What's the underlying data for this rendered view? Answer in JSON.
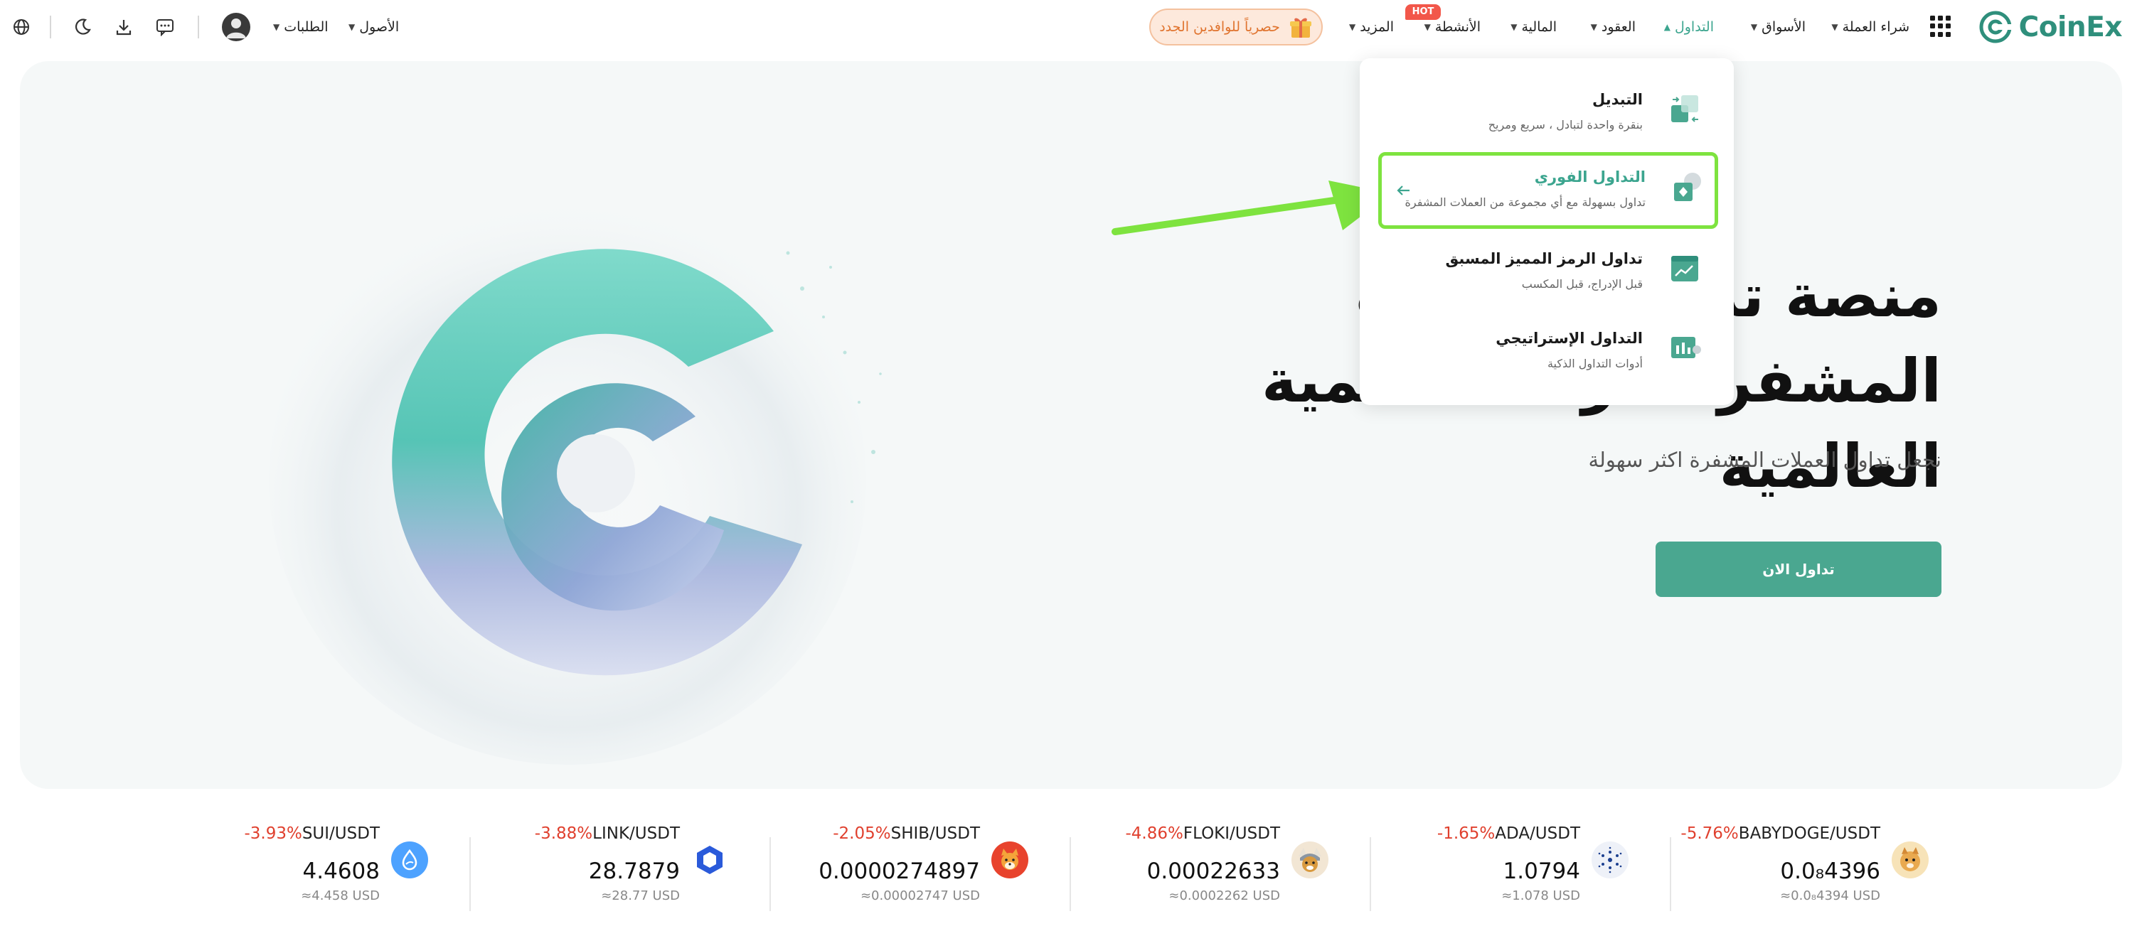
{
  "header": {
    "logo": "CoinEx",
    "nav": [
      {
        "label": "شراء العملة",
        "caret": true,
        "active": false
      },
      {
        "label": "الأسواق",
        "caret": true,
        "active": false
      },
      {
        "label": "التداول",
        "caret": true,
        "active": true
      },
      {
        "label": "العقود",
        "caret": true,
        "active": false
      },
      {
        "label": "المالية",
        "caret": true,
        "active": false
      },
      {
        "label": "الأنشطة",
        "caret": true,
        "active": false
      },
      {
        "label": "المزيد",
        "caret": true,
        "active": false
      }
    ],
    "hot_badge": "HOT",
    "promo_label": "حصرياً للوافدين الجدد",
    "assets_label": "الأصول",
    "orders_label": "الطلبات"
  },
  "dropdown": {
    "items": [
      {
        "title": "التبديل",
        "desc": "بنقرة واحدة لتبادل ، سريع ومريح",
        "icon": "swap-icon"
      },
      {
        "title": "التداول الفوري",
        "desc": "تداول بسهولة مع أي مجموعة من العملات المشفرة",
        "icon": "spot-icon",
        "highlighted": true
      },
      {
        "title": "تداول الرمز المميز المسبق",
        "desc": "قبل الإدراج، قبل المكسب",
        "icon": "pre-token-icon"
      },
      {
        "title": "التداول الإستراتيجي",
        "desc": "أدوات التداول الذكية",
        "icon": "strategy-icon"
      }
    ]
  },
  "hero": {
    "title_line1": "منصة تداول العملات المشفرة الرائدة عالمية",
    "title_line2": "العالمية",
    "subtitle": "نجعل تداول العملات المشفرة اكثر سهولة",
    "cta": "تداول الان"
  },
  "ticker": [
    {
      "pair": "BABYDOGE/USDT",
      "change": "-5.76%",
      "price": "0.0₈4396",
      "usd": "≈0.0₈4394 USD",
      "icon": "babydoge-icon",
      "color": "#f5c27a"
    },
    {
      "pair": "ADA/USDT",
      "change": "-1.65%",
      "price": "1.0794",
      "usd": "≈1.078 USD",
      "icon": "ada-icon",
      "color": "#1c3f8f"
    },
    {
      "pair": "FLOKI/USDT",
      "change": "-4.86%",
      "price": "0.00022633",
      "usd": "≈0.0002262 USD",
      "icon": "floki-icon",
      "color": "#d99a3f"
    },
    {
      "pair": "SHIB/USDT",
      "change": "-2.05%",
      "price": "0.0000274897",
      "usd": "≈0.00002747 USD",
      "icon": "shib-icon",
      "color": "#e8432d"
    },
    {
      "pair": "LINK/USDT",
      "change": "-3.88%",
      "price": "28.7879",
      "usd": "≈28.77 USD",
      "icon": "link-icon",
      "color": "#2a5ada"
    },
    {
      "pair": "SUI/USDT",
      "change": "-3.93%",
      "price": "4.4608",
      "usd": "≈4.458 USD",
      "icon": "sui-icon",
      "color": "#4da2ff"
    }
  ],
  "colors": {
    "brand": "#2f8f7c",
    "accent": "#4aa790",
    "negative": "#e0402e",
    "highlight_border": "#7ee33f"
  }
}
